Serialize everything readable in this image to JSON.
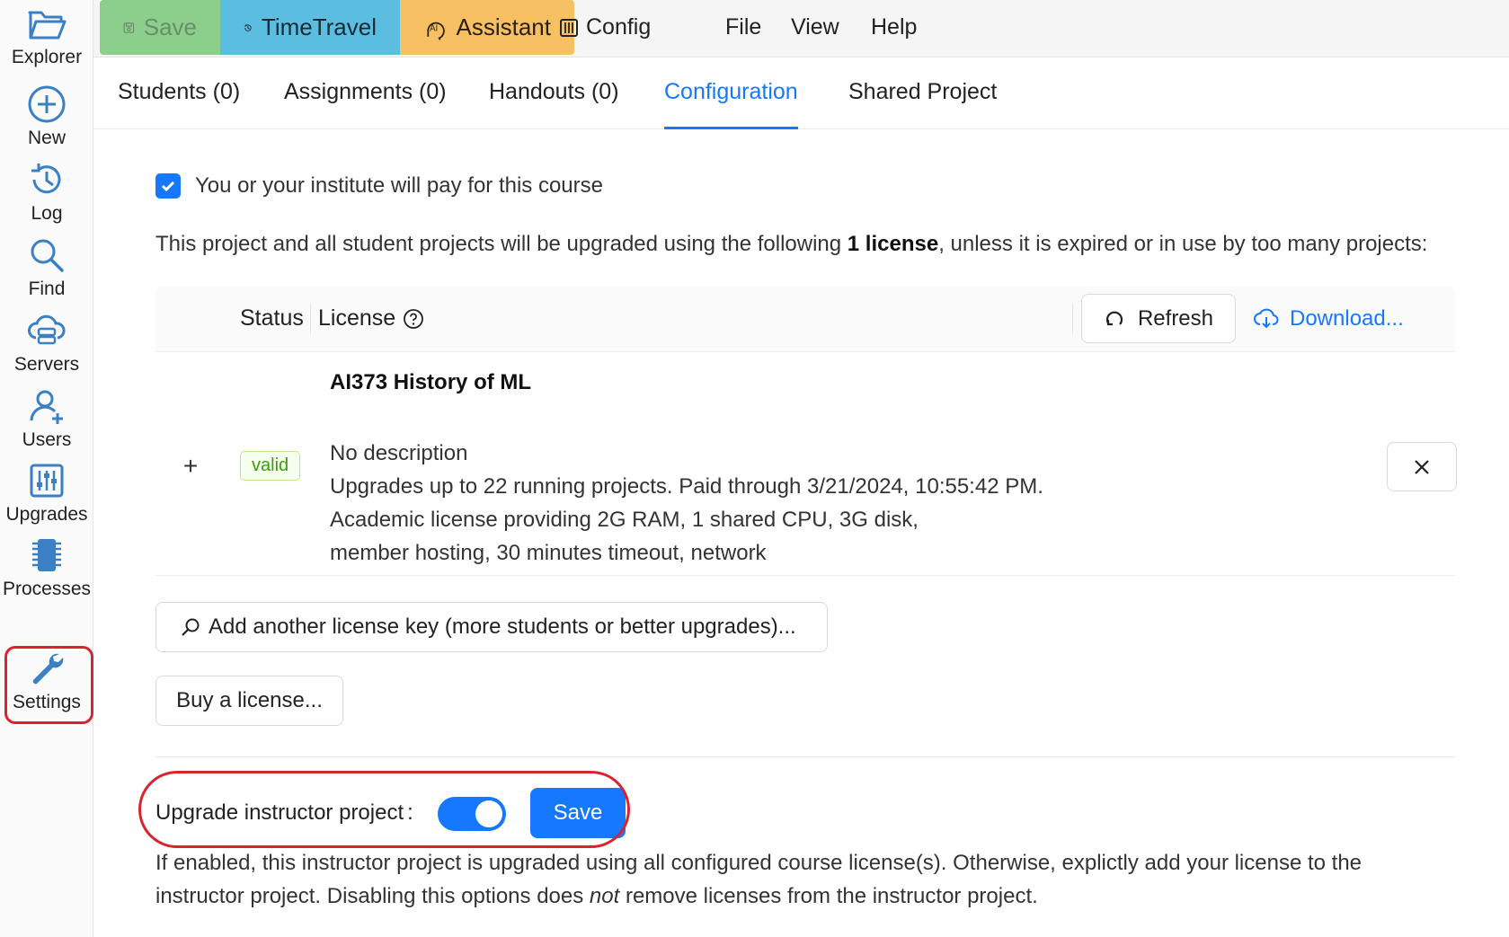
{
  "sidebar": {
    "items": [
      {
        "label": "Explorer",
        "icon": "folder-open-icon"
      },
      {
        "label": "New",
        "icon": "plus-circle-icon"
      },
      {
        "label": "Log",
        "icon": "history-icon"
      },
      {
        "label": "Find",
        "icon": "search-icon"
      },
      {
        "label": "Servers",
        "icon": "cloud-server-icon"
      },
      {
        "label": "Users",
        "icon": "users-icon"
      },
      {
        "label": "Upgrades",
        "icon": "sliders-icon"
      },
      {
        "label": "Processes",
        "icon": "chip-icon"
      },
      {
        "label": "Settings",
        "icon": "wrench-icon"
      }
    ],
    "icon_color": "#3b7fc4"
  },
  "toolbar": {
    "save_label": "Save",
    "timetravel_label": "TimeTravel",
    "assistant_label": "Assistant",
    "menus": [
      "Config",
      "File",
      "View",
      "Help"
    ]
  },
  "tabs": [
    "Students (0)",
    "Assignments (0)",
    "Handouts (0)",
    "Configuration",
    "Shared Project"
  ],
  "active_tab": "Configuration",
  "config": {
    "pay_checkbox_label": "You or your institute will pay for this course",
    "pay_checked": true,
    "intro_before": "This project and all student projects will be upgraded using the following ",
    "intro_bold": "1 license",
    "intro_after": ", unless it is expired or in use by too many projects:",
    "table": {
      "col_status": "Status",
      "col_license": "License",
      "refresh_label": "Refresh",
      "download_label": "Download...",
      "rows": [
        {
          "status": "valid",
          "title": "AI373 History of ML",
          "description": "No description",
          "line1": "Upgrades up to 22 running projects. Paid through 3/21/2024, 10:55:42 PM.",
          "line2": "Academic license providing 2G RAM, 1 shared CPU, 3G disk, member hosting, 30 minutes timeout, network"
        }
      ]
    },
    "add_license_label": "Add another license key (more students or better upgrades)...",
    "buy_license_label": "Buy a license...",
    "upgrade_label": "Upgrade instructor project",
    "upgrade_enabled": true,
    "upgrade_save_label": "Save",
    "note_before": "If enabled, this instructor project is upgraded using all configured course license(s). Otherwise, explictly add your license to the instructor project. Disabling this options does ",
    "note_em": "not",
    "note_after": " remove licenses from the instructor project."
  },
  "colors": {
    "accent": "#1677ff",
    "save_bg": "#8ccf8c",
    "timetravel_bg": "#5bbde0",
    "assistant_bg": "#f7c163",
    "highlight_ring": "#d9232d",
    "valid_green": "#389e0d"
  }
}
